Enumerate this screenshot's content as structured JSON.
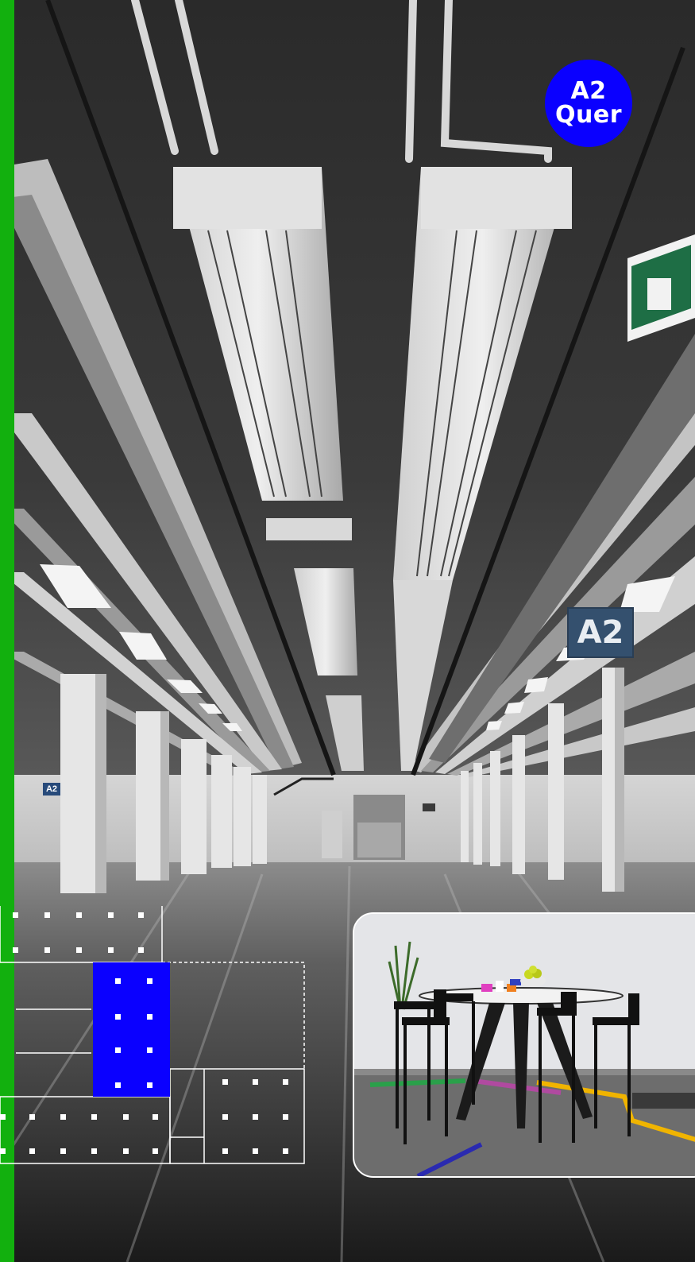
{
  "badge": {
    "line1": "A2",
    "line2": "Quer",
    "color": "#0a00ff"
  },
  "hall_sign": {
    "text": "A2"
  },
  "hall_sign_small": {
    "text": "A2"
  },
  "accent_strip_color": "#12b00e",
  "floorplan": {
    "highlight_color": "#0a00ff",
    "line_color": "#ffffff"
  },
  "photo": {
    "subject": "black-bar-table-with-four-stools"
  }
}
